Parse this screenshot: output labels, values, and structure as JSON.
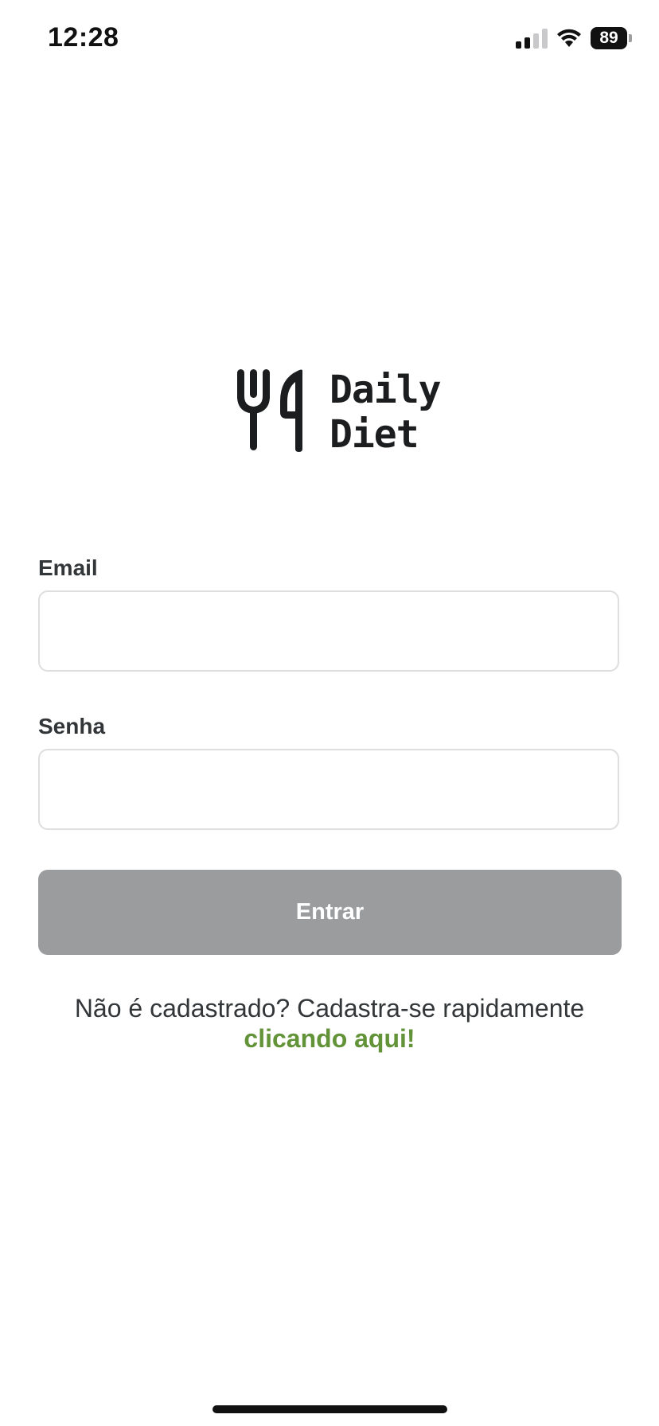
{
  "status_bar": {
    "time": "12:28",
    "battery": "89",
    "icons": [
      "cellular-signal-icon",
      "wifi-icon",
      "battery-icon"
    ]
  },
  "logo": {
    "line1": "Daily",
    "line2": "Diet",
    "icon": "fork-knife-icon"
  },
  "form": {
    "email_label": "Email",
    "email_value": "",
    "password_label": "Senha",
    "password_value": "",
    "submit_label": "Entrar"
  },
  "signup": {
    "text": "Não é cadastrado? Cadastra-se rapidamente",
    "link": "clicando aqui!"
  },
  "colors": {
    "button_disabled": "#9b9c9e",
    "link_green": "#639339",
    "text": "#333638",
    "input_border": "#dddedf"
  }
}
